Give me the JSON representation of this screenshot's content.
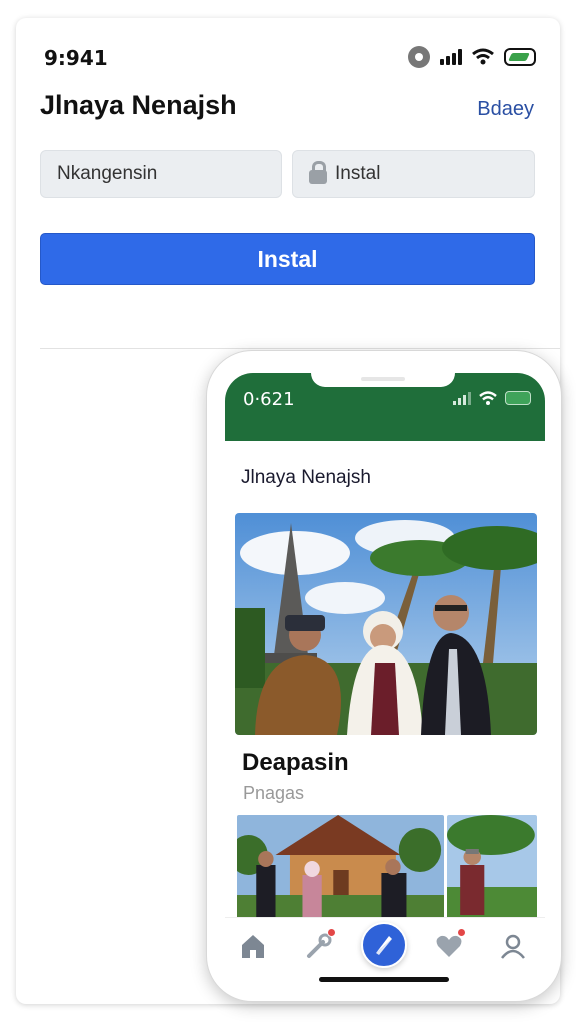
{
  "status_bar": {
    "time": "9:941"
  },
  "header": {
    "title": "Jlnaya Nenajsh",
    "link": "Bdaey"
  },
  "form": {
    "field_left_value": "Nkangensin",
    "field_right_value": "Instal",
    "install_label": "Instal"
  },
  "phone": {
    "time": "0·621",
    "title": "Jlnaya Nenajsh",
    "card_title": "Deapasin",
    "card_subtitle": "Pnagas"
  },
  "colors": {
    "accent": "#2f6ae8",
    "phone_status": "#1f6e3a",
    "link": "#2a4fa3",
    "badge": "#e34747"
  },
  "icons": {
    "tabs": [
      "home-icon",
      "tools-icon",
      "compass-icon",
      "heart-icon",
      "profile-icon"
    ]
  }
}
